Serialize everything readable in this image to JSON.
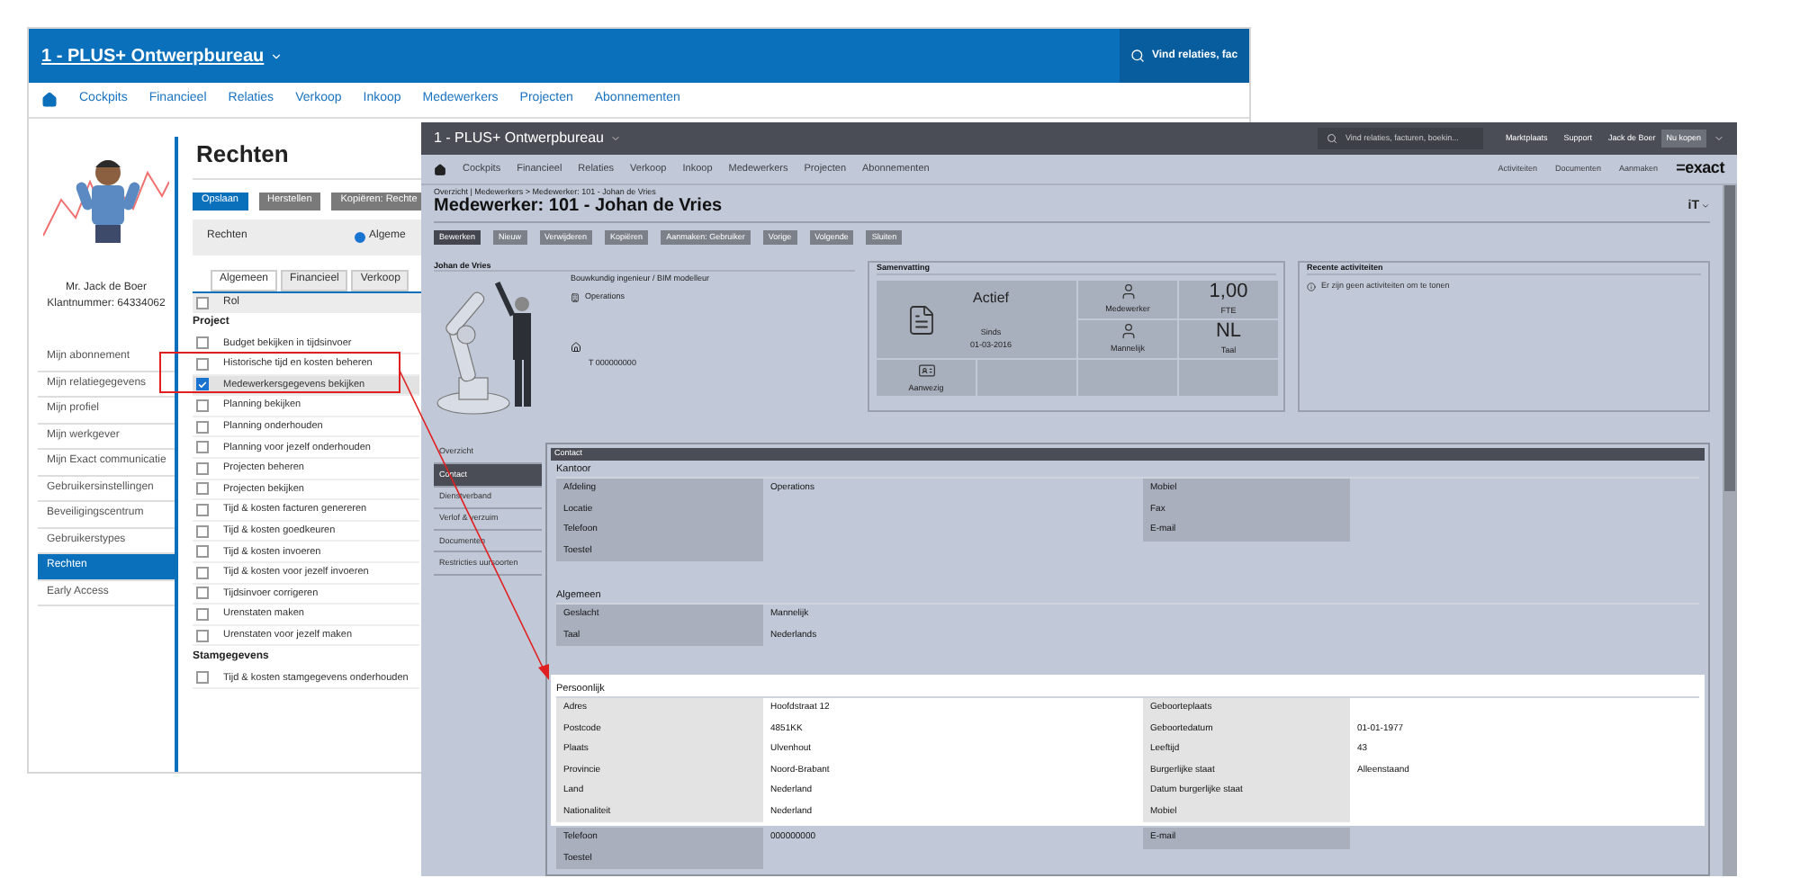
{
  "back_window": {
    "title": "1 - PLUS+ Ontwerpbureau",
    "search": {
      "placeholder": "Vind relaties, fac"
    },
    "nav": [
      "Cockpits",
      "Financieel",
      "Relaties",
      "Verkoop",
      "Inkoop",
      "Medewerkers",
      "Projecten",
      "Abonnementen"
    ],
    "profile": {
      "name": "Mr. Jack de Boer",
      "customer_number": "Klantnummer: 64334062"
    },
    "menu": [
      {
        "label": "Mijn abonnement",
        "selected": false
      },
      {
        "label": "Mijn relatiegegevens",
        "selected": false
      },
      {
        "label": "Mijn profiel",
        "selected": false
      },
      {
        "label": "Mijn werkgever",
        "selected": false
      },
      {
        "label": "Mijn Exact communicatie",
        "selected": false
      },
      {
        "label": "Gebruikersinstellingen",
        "selected": false
      },
      {
        "label": "Beveiligingscentrum",
        "selected": false
      },
      {
        "label": "Gebruikerstypes",
        "selected": false
      },
      {
        "label": "Rechten",
        "selected": true
      },
      {
        "label": "Early Access",
        "selected": false
      }
    ],
    "page_title": "Rechten",
    "buttons": [
      {
        "label": "Opslaan",
        "primary": true
      },
      {
        "label": "Herstellen",
        "primary": false
      },
      {
        "label": "Kopiëren: Rechte",
        "primary": false
      }
    ],
    "filter": {
      "label": "Rechten",
      "option": "Algeme",
      "selected": true
    },
    "tabs": [
      {
        "label": "Algemeen",
        "selected": true
      },
      {
        "label": "Financieel",
        "selected": false
      },
      {
        "label": "Verkoop",
        "selected": false
      }
    ],
    "header": {
      "label": "Rol",
      "checked": false
    },
    "groups": [
      {
        "title": "Project",
        "items": [
          {
            "label": "Budget bekijken in tijdsinvoer",
            "checked": false,
            "selected": false
          },
          {
            "label": "Historische tijd en kosten beheren",
            "checked": false,
            "selected": false
          },
          {
            "label": "Medewerkersgegevens bekijken",
            "checked": true,
            "selected": true
          },
          {
            "label": "Planning bekijken",
            "checked": false,
            "selected": false
          },
          {
            "label": "Planning onderhouden",
            "checked": false,
            "selected": false
          },
          {
            "label": "Planning voor jezelf onderhouden",
            "checked": false,
            "selected": false
          },
          {
            "label": "Projecten beheren",
            "checked": false,
            "selected": false
          },
          {
            "label": "Projecten bekijken",
            "checked": false,
            "selected": false
          },
          {
            "label": "Tijd & kosten facturen genereren",
            "checked": false,
            "selected": false
          },
          {
            "label": "Tijd & kosten goedkeuren",
            "checked": false,
            "selected": false
          },
          {
            "label": "Tijd & kosten invoeren",
            "checked": false,
            "selected": false
          },
          {
            "label": "Tijd & kosten voor jezelf invoeren",
            "checked": false,
            "selected": false
          },
          {
            "label": "Tijdsinvoer corrigeren",
            "checked": false,
            "selected": false
          },
          {
            "label": "Urenstaten maken",
            "checked": false,
            "selected": false
          },
          {
            "label": "Urenstaten voor jezelf maken",
            "checked": false,
            "selected": false
          }
        ]
      },
      {
        "title": "Stamgegevens",
        "items": [
          {
            "label": "Tijd & kosten stamgegevens onderhouden",
            "checked": false,
            "selected": false
          }
        ]
      }
    ]
  },
  "front_window": {
    "title": "1 - PLUS+ Ontwerpbureau",
    "search": {
      "placeholder": "Vind relaties, facturen, boekin..."
    },
    "top_links": [
      "Marktplaats",
      "Support",
      "Jack de Boer"
    ],
    "buy_button": "Nu kopen",
    "nav": [
      "Cockpits",
      "Financieel",
      "Relaties",
      "Verkoop",
      "Inkoop",
      "Medewerkers",
      "Projecten",
      "Abonnementen"
    ],
    "nav_right": [
      "Activiteiten",
      "Documenten",
      "Aanmaken"
    ],
    "logo": "=exact",
    "breadcrumb": "Overzicht | Medewerkers > Medewerker: 101 - Johan de Vries",
    "page_title": "Medewerker: 101 - Johan de Vries",
    "language": "iT",
    "toolbar": [
      {
        "label": "Bewerken",
        "primary": true
      },
      {
        "label": "Nieuw",
        "primary": false
      },
      {
        "label": "Verwijderen",
        "primary": false
      },
      {
        "label": "Kopiëren",
        "primary": false
      },
      {
        "label": "Aanmaken: Gebruiker",
        "primary": false
      },
      {
        "label": "Vorige",
        "primary": false
      },
      {
        "label": "Volgende",
        "primary": false
      },
      {
        "label": "Sluiten",
        "primary": false
      }
    ],
    "profile_card": {
      "title": "Johan de Vries",
      "job": "Bouwkundig ingenieur / BIM modelleur",
      "department": "Operations",
      "phone": "T 000000000"
    },
    "summary": {
      "title": "Samenvatting",
      "status": "Actief",
      "since": "Sinds",
      "since_date": "01-03-2016",
      "tiles": [
        {
          "kind": "person",
          "label": "Medewerker"
        },
        {
          "kind": "value",
          "value": "1,00",
          "label": "FTE"
        },
        {
          "kind": "person",
          "label": "Mannelijk"
        },
        {
          "kind": "value",
          "value": "NL",
          "label": "Taal"
        },
        {
          "kind": "badge",
          "label": "Aanwezig"
        }
      ]
    },
    "recent": {
      "title": "Recente activiteiten",
      "empty": "Er zijn geen activiteiten om te tonen"
    },
    "side_tabs": [
      {
        "label": "Overzicht",
        "selected": false
      },
      {
        "label": "Contact",
        "selected": true
      },
      {
        "label": "Dienstverband",
        "selected": false
      },
      {
        "label": "Verlof & verzuim",
        "selected": false
      },
      {
        "label": "Documenten",
        "selected": false
      },
      {
        "label": "Restricties uursoorten",
        "selected": false
      }
    ],
    "panel_title": "Contact",
    "sections": [
      {
        "title": "Kantoor",
        "highlighted": false,
        "rows": [
          {
            "label": "Afdeling",
            "value": "Operations",
            "label2": "Mobiel"
          },
          {
            "label": "Locatie",
            "label2": "Fax"
          },
          {
            "label": "Telefoon",
            "label2": "E-mail"
          },
          {
            "label": "Toestel"
          }
        ]
      },
      {
        "title": "Algemeen",
        "highlighted": false,
        "rows": [
          {
            "label": "Geslacht",
            "value": "Mannelijk"
          },
          {
            "label": "Taal",
            "value": "Nederlands"
          }
        ]
      },
      {
        "title": "Persoonlijk",
        "highlighted": true,
        "rows": [
          {
            "label": "Adres",
            "value": "Hoofdstraat 12",
            "label2": "Geboorteplaats"
          },
          {
            "label": "Postcode",
            "value": "4851KK",
            "label2": "Geboortedatum",
            "value2": "01-01-1977"
          },
          {
            "label": "Plaats",
            "value": "Ulvenhout",
            "label2": "Leeftijd",
            "value2": "43"
          },
          {
            "label": "Provincie",
            "value": "Noord-Brabant",
            "label2": "Burgerlijke staat",
            "value2": "Alleenstaand"
          },
          {
            "label": "Land",
            "value": "Nederland",
            "label2": "Datum burgerlijke staat"
          },
          {
            "label": "Nationaliteit",
            "value": "Nederland",
            "label2": "Mobiel"
          }
        ]
      },
      {
        "highlighted": false,
        "rows": [
          {
            "label": "Telefoon",
            "value": "000000000",
            "label2": "E-mail"
          },
          {
            "label": "Toestel"
          }
        ]
      }
    ]
  }
}
